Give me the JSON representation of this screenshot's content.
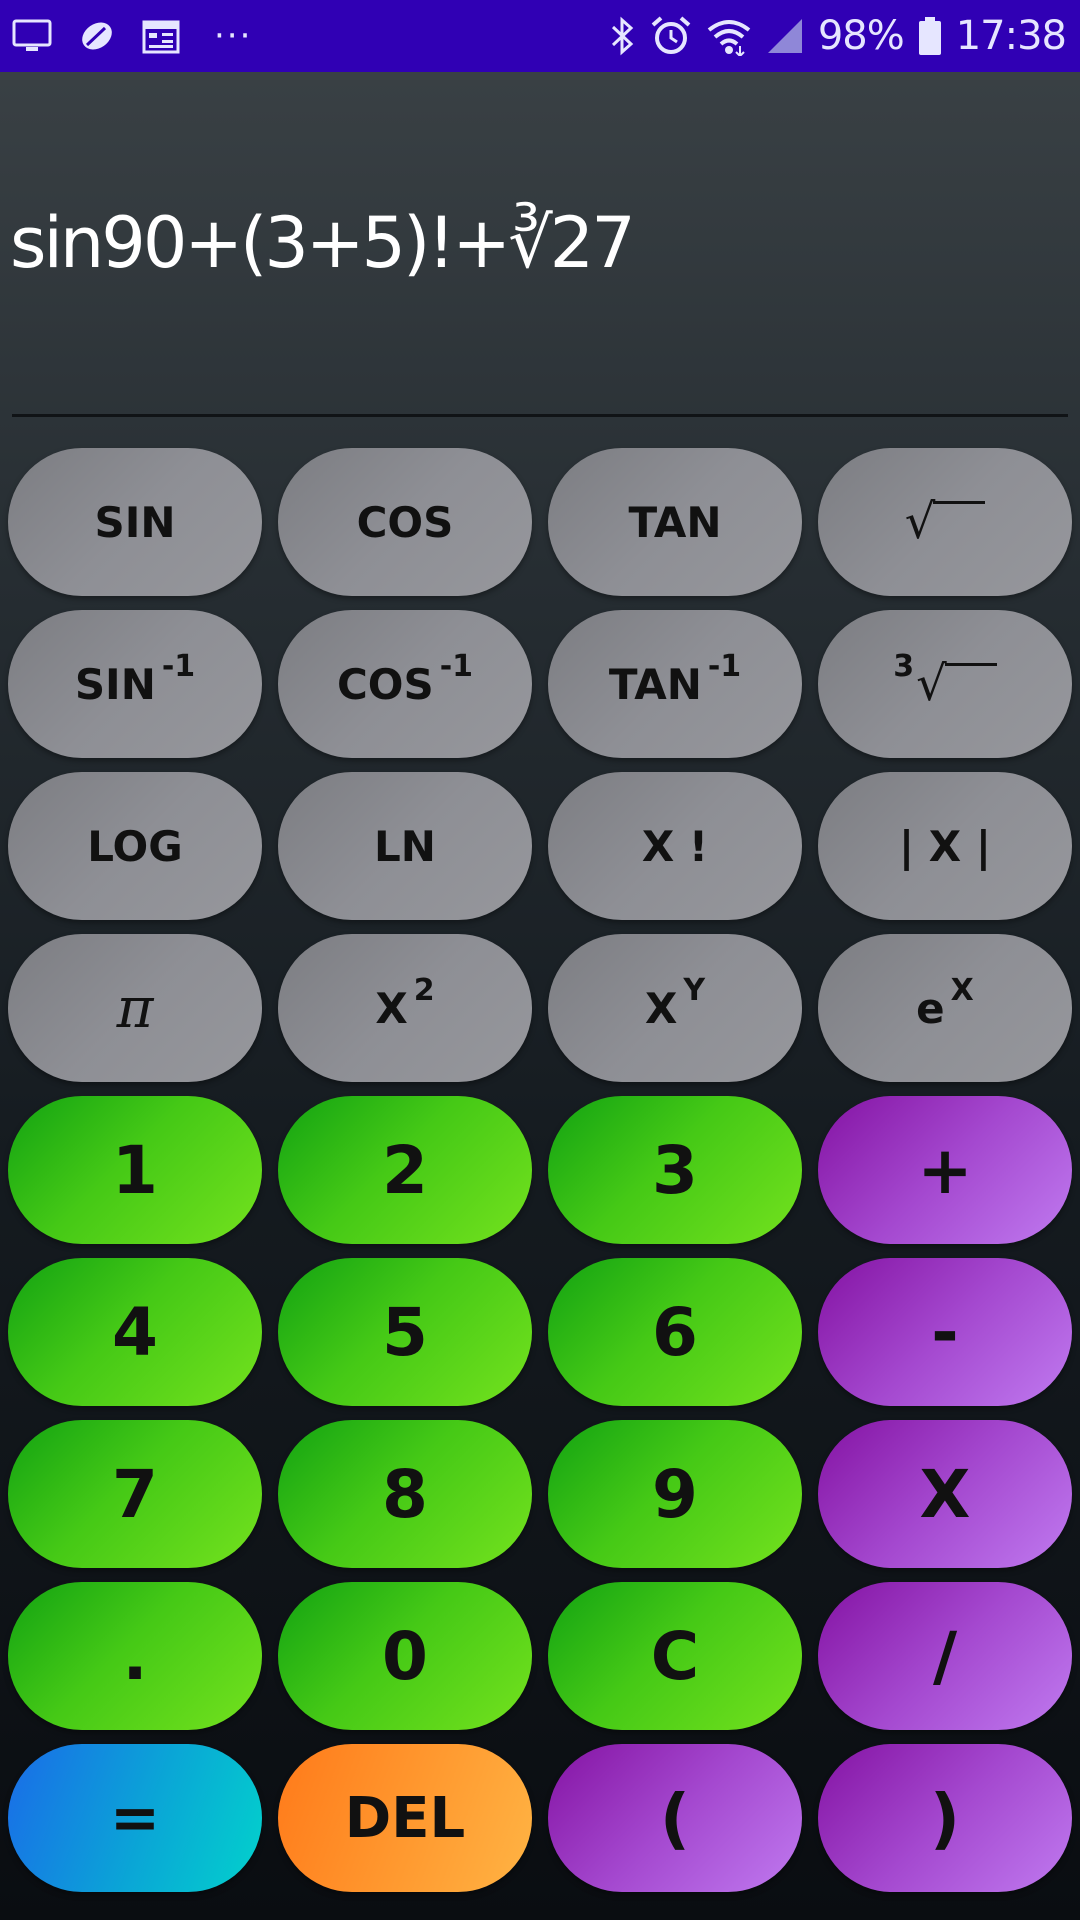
{
  "status_bar": {
    "battery": "98%",
    "time": "17:38",
    "left_icons": [
      "monitor-icon",
      "leaf-icon",
      "calendar-icon",
      "more-dots-icon"
    ],
    "right_icons": [
      "bluetooth-icon",
      "alarm-icon",
      "wifi-icon",
      "signal-icon",
      "battery-icon"
    ],
    "background_color": "#3000b4"
  },
  "display": {
    "expression": "sin90+(3+5)!+∛27"
  },
  "keypad": {
    "rows": [
      [
        {
          "label": "SIN",
          "sup": "",
          "kind": "sci"
        },
        {
          "label": "COS",
          "sup": "",
          "kind": "sci"
        },
        {
          "label": "TAN",
          "sup": "",
          "kind": "sci"
        },
        {
          "label": "√",
          "sup": "",
          "kind": "sci"
        }
      ],
      [
        {
          "label": "SIN",
          "sup": "-1",
          "kind": "sci"
        },
        {
          "label": "COS",
          "sup": "-1",
          "kind": "sci"
        },
        {
          "label": "TAN",
          "sup": "-1",
          "kind": "sci"
        },
        {
          "label": "√",
          "presup": "3",
          "kind": "sci"
        }
      ],
      [
        {
          "label": "LOG",
          "kind": "sci"
        },
        {
          "label": "LN",
          "kind": "sci"
        },
        {
          "label": "X !",
          "kind": "sci"
        },
        {
          "label": "| X |",
          "kind": "sci"
        }
      ],
      [
        {
          "label": "π",
          "kind": "sci"
        },
        {
          "label": "X",
          "sup": "2",
          "kind": "sci"
        },
        {
          "label": "X",
          "sup": "Y",
          "kind": "sci"
        },
        {
          "label": "e",
          "sup": "X",
          "kind": "sci"
        }
      ],
      [
        {
          "label": "1",
          "kind": "num"
        },
        {
          "label": "2",
          "kind": "num"
        },
        {
          "label": "3",
          "kind": "num"
        },
        {
          "label": "+",
          "kind": "op"
        }
      ],
      [
        {
          "label": "4",
          "kind": "num"
        },
        {
          "label": "5",
          "kind": "num"
        },
        {
          "label": "6",
          "kind": "num"
        },
        {
          "label": "-",
          "kind": "op"
        }
      ],
      [
        {
          "label": "7",
          "kind": "num"
        },
        {
          "label": "8",
          "kind": "num"
        },
        {
          "label": "9",
          "kind": "num"
        },
        {
          "label": "X",
          "kind": "op"
        }
      ],
      [
        {
          "label": ".",
          "kind": "num"
        },
        {
          "label": "0",
          "kind": "num"
        },
        {
          "label": "C",
          "kind": "num"
        },
        {
          "label": "/",
          "kind": "op"
        }
      ],
      [
        {
          "label": "=",
          "kind": "eq"
        },
        {
          "label": "DEL",
          "kind": "del"
        },
        {
          "label": "(",
          "kind": "op"
        },
        {
          "label": ")",
          "kind": "op"
        }
      ]
    ]
  },
  "colors": {
    "scientific_key": "#8e8f95",
    "number_key": "#45c916",
    "operator_key": "#a448cf",
    "equals_key": "#0aa6d6",
    "delete_key": "#ff9a30"
  }
}
